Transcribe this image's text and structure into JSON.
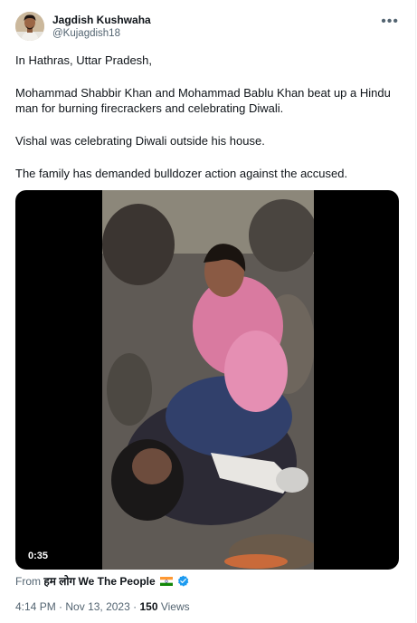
{
  "tweet": {
    "display_name": "Jagdish Kushwaha",
    "handle": "@Kujagdish18",
    "more_icon": "more-horizontal-icon",
    "paragraphs": [
      "In Hathras, Uttar Pradesh,",
      "Mohammad Shabbir Khan and Mohammad Bablu Khan beat up a Hindu man for burning firecrackers and celebrating Diwali.",
      "Vishal was celebrating Diwali outside his house.",
      "The family has demanded bulldozer action against the accused."
    ],
    "video": {
      "duration": "0:35"
    },
    "source": {
      "prefix": "From",
      "name": "हम लोग We The People",
      "flag_icon": "india-flag-icon",
      "verified_icon": "verified-badge-icon",
      "verified_color": "#1d9bf0"
    },
    "meta": {
      "time": "4:14 PM",
      "separator": "·",
      "date": "Nov 13, 2023",
      "views_count": "150",
      "views_label": "Views"
    }
  }
}
